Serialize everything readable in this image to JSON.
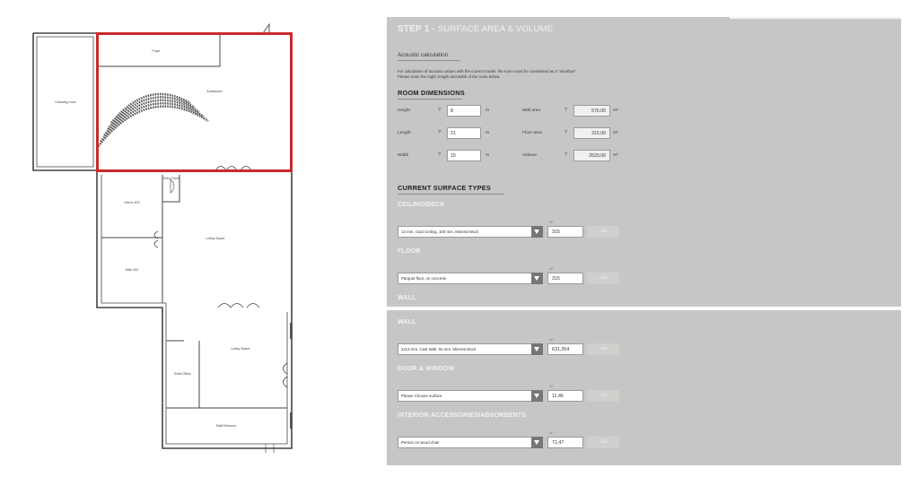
{
  "floor_plan": {
    "rooms": {
      "foyer": "Foyer",
      "cleaning_room": "Cleaning room",
      "auditorium": "Auditorium",
      "room_a": "Interlo 403",
      "room_b": "Main 402",
      "lobby_top": "Lobby Space",
      "lobby_bottom": "Lobby Space",
      "small_top": "Entry Store",
      "office": "Ticket Office",
      "staff": "Staff Entrance"
    },
    "colors": {
      "highlight": "#cc2a2a",
      "walls": "#444444"
    }
  },
  "step": {
    "prefix": "STEP 1 -",
    "title": "SURFACE AREA & VOLUME"
  },
  "acoustic": {
    "title": "Acoustic calculation",
    "desc_line1": "For calculation of acoustic values with the current model, the room must be considered as a \"shoebox\".",
    "desc_line2": "Please enter the hight, length and width of the room below."
  },
  "dimensions": {
    "heading": "ROOM DIMENSIONS",
    "help": "?",
    "height_label": "Height",
    "height_value": "8",
    "length_label": "Length",
    "length_value": "21",
    "width_label": "Width",
    "width_value": "15",
    "unit_m": "m",
    "wall_area_label": "Wall area",
    "wall_area_value": "576,00",
    "floor_area_label": "Floor area",
    "floor_area_value": "315,00",
    "volume_label": "Volume",
    "volume_value": "2520,00",
    "unit_m2": "m²",
    "unit_m3": "m³"
  },
  "surfaces": {
    "heading": "CURRENT SURFACE TYPES",
    "m2_label": "m²",
    "add_label": "Add",
    "ceiling": {
      "title": "CEILING/DECK",
      "selected": "13 mm. Cast Ceiling, 100 mm. Mineral Wool",
      "quantity": "315"
    },
    "floor": {
      "title": "FLOOR",
      "selected": "Parquet floor, on concrete",
      "quantity": "315"
    },
    "wall_cut_title": "WALL"
  },
  "surfaces2": {
    "wall": {
      "title": "WALL",
      "selected": "2x13 mm. Cast Wall, 50 mm. Mineral Wool",
      "quantity": "631,354"
    },
    "door_window": {
      "title": "DOOR & WINDOW",
      "selected": "Please Choose surface",
      "quantity": "11,46"
    },
    "interior": {
      "title": "INTERIOR ACCESSORIES/ABSORBENTS",
      "selected": "Person on wood chair",
      "quantity": "71,47"
    }
  }
}
